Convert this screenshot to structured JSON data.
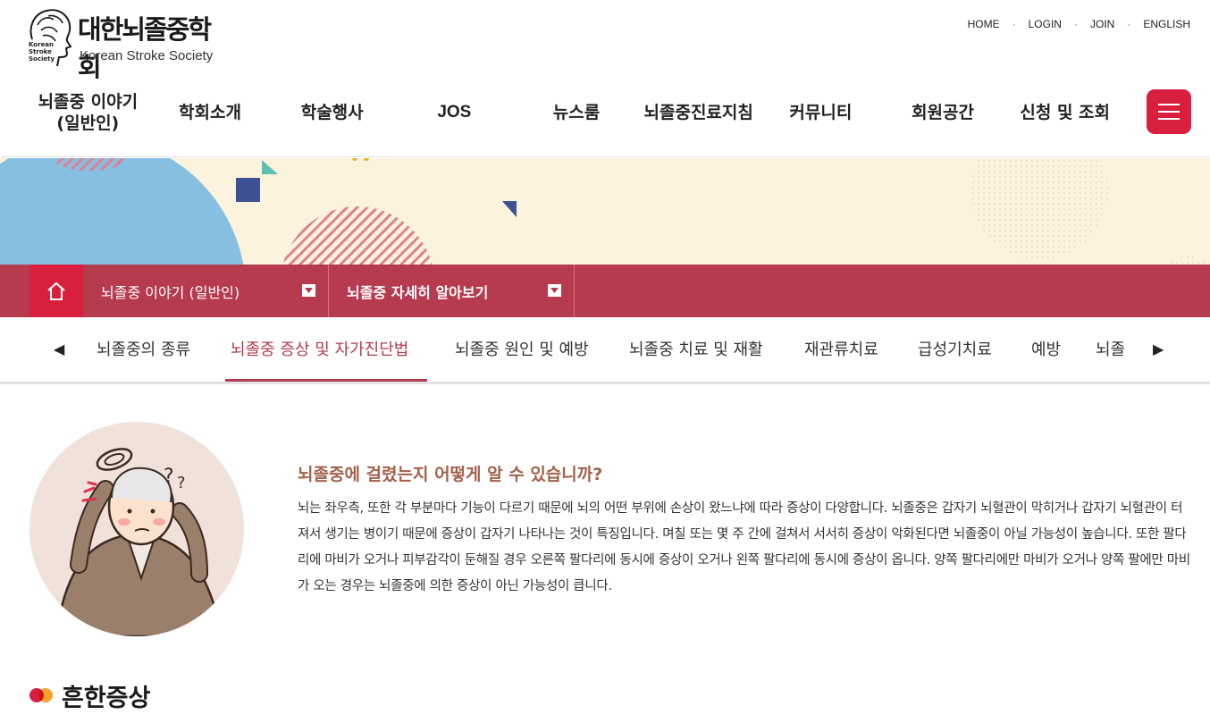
{
  "brand": {
    "name_kr": "대한뇌졸중학회",
    "name_en": "Korean Stroke Society",
    "mark_lines": [
      "Korean",
      "Stroke",
      "Society"
    ]
  },
  "util_links": [
    "HOME",
    "LOGIN",
    "JOIN",
    "ENGLISH"
  ],
  "gnb": [
    "뇌졸중 이야기\n(일반인)",
    "학회소개",
    "학술행사",
    "JOS",
    "뉴스룸",
    "뇌졸중진료지침",
    "커뮤니티",
    "회원공간",
    "신청 및 조회"
  ],
  "breadcrumb": {
    "level1": "뇌졸중 이야기 (일반인)",
    "level2": "뇌졸중 자세히 알아보기"
  },
  "tabs": {
    "items": [
      "뇌졸중의 종류",
      "뇌졸중 증상 및 자가진단법",
      "뇌졸중 원인 및 예방",
      "뇌졸중 치료 및 재활",
      "재관류치료",
      "급성기치료",
      "예방",
      "뇌졸"
    ],
    "active_index": 1
  },
  "content": {
    "question": "뇌졸중에 걸렸는지 어떻게 알 수 있습니까?",
    "body": "뇌는 좌우측, 또한 각 부분마다 기능이 다르기 때문에 뇌의 어떤 부위에 손상이 왔느냐에 따라 증상이 다양합니다. 뇌졸중은 갑자기 뇌혈관이 막히거나 갑자기 뇌혈관이 터져서 생기는 병이기 때문에 증상이 갑자기 나타나는 것이 특징입니다. 며칠 또는 몇 주 간에 걸쳐서 서서히 증상이 악화된다면 뇌졸중이 아닐 가능성이 높습니다. 또한 팔다리에 마비가 오거나 피부감각이 둔해질 경우 오른쪽 팔다리에 동시에 증상이 오거나 왼쪽 팔다리에 동시에 증상이 옵니다. 양쪽 팔다리에만 마비가 오거나 양쪽 팔에만 마비가 오는 경우는 뇌졸중에 의한 증상이 아닌 가능성이 큽니다.",
    "section_title": "흔한증상"
  },
  "colors": {
    "accent_red": "#d91f3e",
    "crumb_bg": "#b63b4f",
    "question_color": "#a3604a",
    "banner_bg": "#fbf3dd"
  },
  "icons": [
    "brain-head-icon",
    "hamburger-icon",
    "home-icon",
    "caret-down-icon",
    "arrow-left-icon",
    "arrow-right-icon"
  ]
}
